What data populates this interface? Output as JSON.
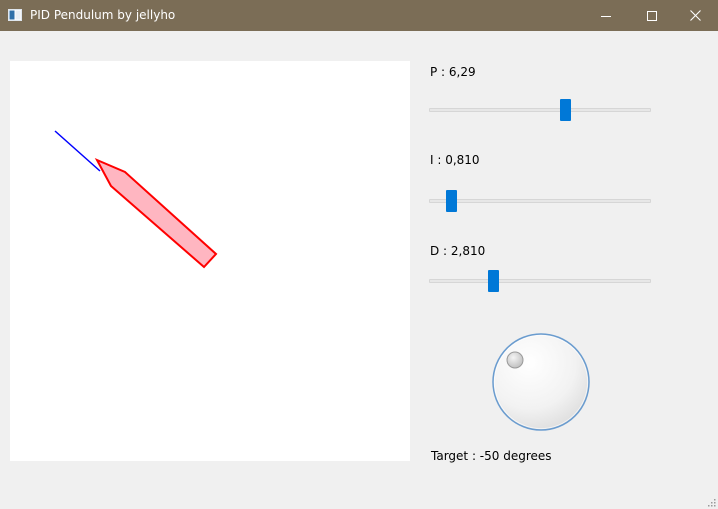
{
  "window": {
    "title": "PID Pendulum by jellyho",
    "controls": [
      "minimize",
      "maximize",
      "close"
    ],
    "titlebar_color": "#7b6d56"
  },
  "simulation": {
    "rod_color": "#0000ff",
    "body_stroke": "#ff0000",
    "body_fill": "#ffb6c1"
  },
  "controls": {
    "p": {
      "label": "P : 6,29",
      "value": 6.29,
      "position": 0.62
    },
    "i": {
      "label": "I : 0,810",
      "value": 0.81,
      "position": 0.08
    },
    "d": {
      "label": "D : 2,810",
      "value": 2.81,
      "position": 0.28
    },
    "slider_color": "#0078d7"
  },
  "target": {
    "label": "Target : -50 degrees",
    "degrees": -50
  }
}
